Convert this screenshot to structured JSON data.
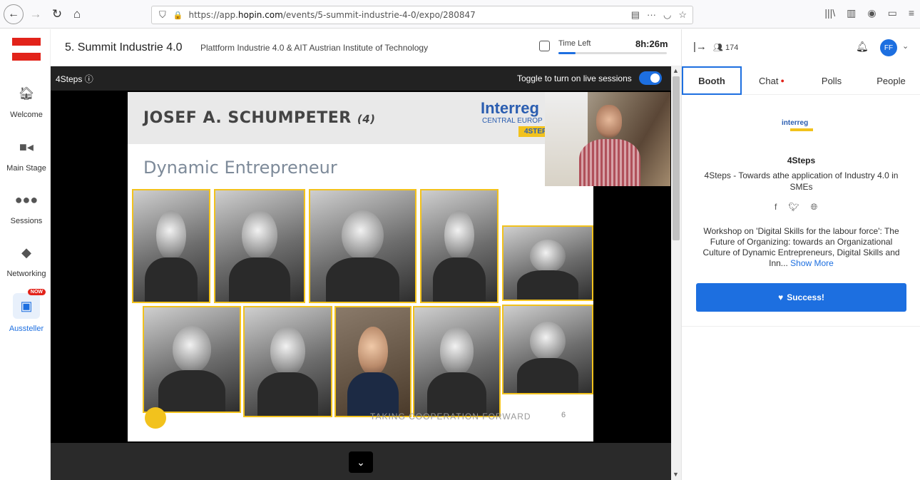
{
  "browser": {
    "url_prefix": "https://app.",
    "url_host": "hopin.com",
    "url_path": "/events/5-summit-industrie-4-0/expo/280847"
  },
  "sidebar": {
    "items": [
      {
        "label": "Welcome",
        "icon": "home-icon"
      },
      {
        "label": "Main Stage",
        "icon": "video-camera-icon"
      },
      {
        "label": "Sessions",
        "icon": "people-group-icon"
      },
      {
        "label": "Networking",
        "icon": "handshake-icon"
      },
      {
        "label": "Aussteller",
        "icon": "booth-icon",
        "badge": "NOW"
      }
    ]
  },
  "header": {
    "title": "5. Summit Industrie 4.0",
    "organizer": "Plattform Industrie 4.0 & AIT Austrian Institute of Technology",
    "time_left_label": "Time Left",
    "time_left_value": "8h:26m",
    "time_progress": 0.16
  },
  "stage": {
    "booth_name": "4Steps",
    "toggle_label": "Toggle to turn on live sessions",
    "toggle_on": true
  },
  "slide": {
    "title": "JOSEF A. SCHUMPETER",
    "title_num": "(4)",
    "logo": "Interreg",
    "logo_sub": "CENTRAL EUROP",
    "logo_tag": "4STEP",
    "subtitle": "Dynamic Entrepreneur",
    "footer": "TAKING COOPERATION FORWARD",
    "page": "6"
  },
  "panel": {
    "attendees": "174",
    "avatar_initials": "FF",
    "tabs": [
      "Booth",
      "Chat",
      "Polls",
      "People"
    ],
    "booth_logo": "interreg",
    "booth_title": "4Steps",
    "booth_subtitle": "4Steps - Towards athe application of Industry 4.0 in SMEs",
    "booth_description": "Workshop on 'Digital Skills for the labour force': The Future of Organizing: towards an Organizational Culture of Dynamic Entrepreneurs, Digital Skills and Inn...",
    "show_more": "Show More",
    "cta": "Success!"
  },
  "colors": {
    "accent": "#1d6fe0",
    "austria_red": "#e2231a",
    "slide_gold": "#f2c21d"
  }
}
